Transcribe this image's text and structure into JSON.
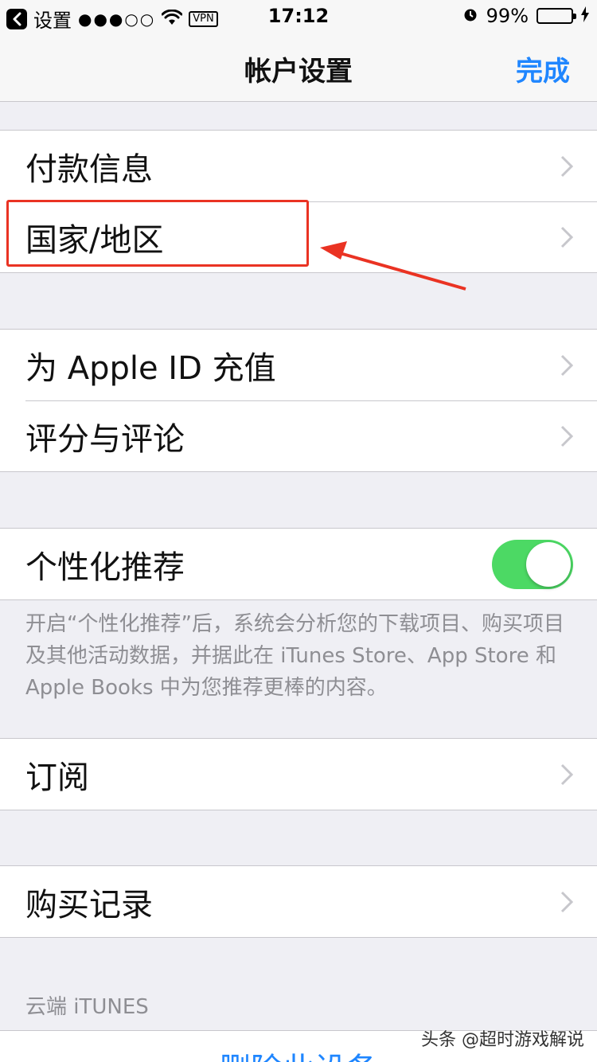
{
  "status_bar": {
    "back_label": "设置",
    "signal": "●●●○○",
    "vpn": "VPN",
    "time": "17:12",
    "battery": "99%"
  },
  "nav": {
    "title": "帐户设置",
    "done": "完成"
  },
  "groups": [
    {
      "items": [
        {
          "label": "付款信息"
        },
        {
          "label": "国家/地区"
        }
      ]
    },
    {
      "items": [
        {
          "label": "为 Apple ID 充值"
        },
        {
          "label": "评分与评论"
        }
      ]
    },
    {
      "items": [
        {
          "label": "个性化推荐",
          "toggle_on": true
        }
      ]
    },
    {
      "items": [
        {
          "label": "订阅"
        }
      ]
    },
    {
      "items": [
        {
          "label": "购买记录"
        }
      ]
    }
  ],
  "personalized_footnote": "开启“个性化推荐”后，系统会分析您的下载项目、购买项目及其他活动数据，并据此在 iTunes Store、App Store 和 Apple Books 中为您推荐更棒的内容。",
  "cloud_section_header": "云端 iTUNES",
  "remove_device": "删除此设备",
  "watermark": "头条 @超时游戏解说",
  "colors": {
    "accent": "#1f86ff",
    "toggle_on": "#4cd964",
    "annotation": "#ea3323"
  }
}
